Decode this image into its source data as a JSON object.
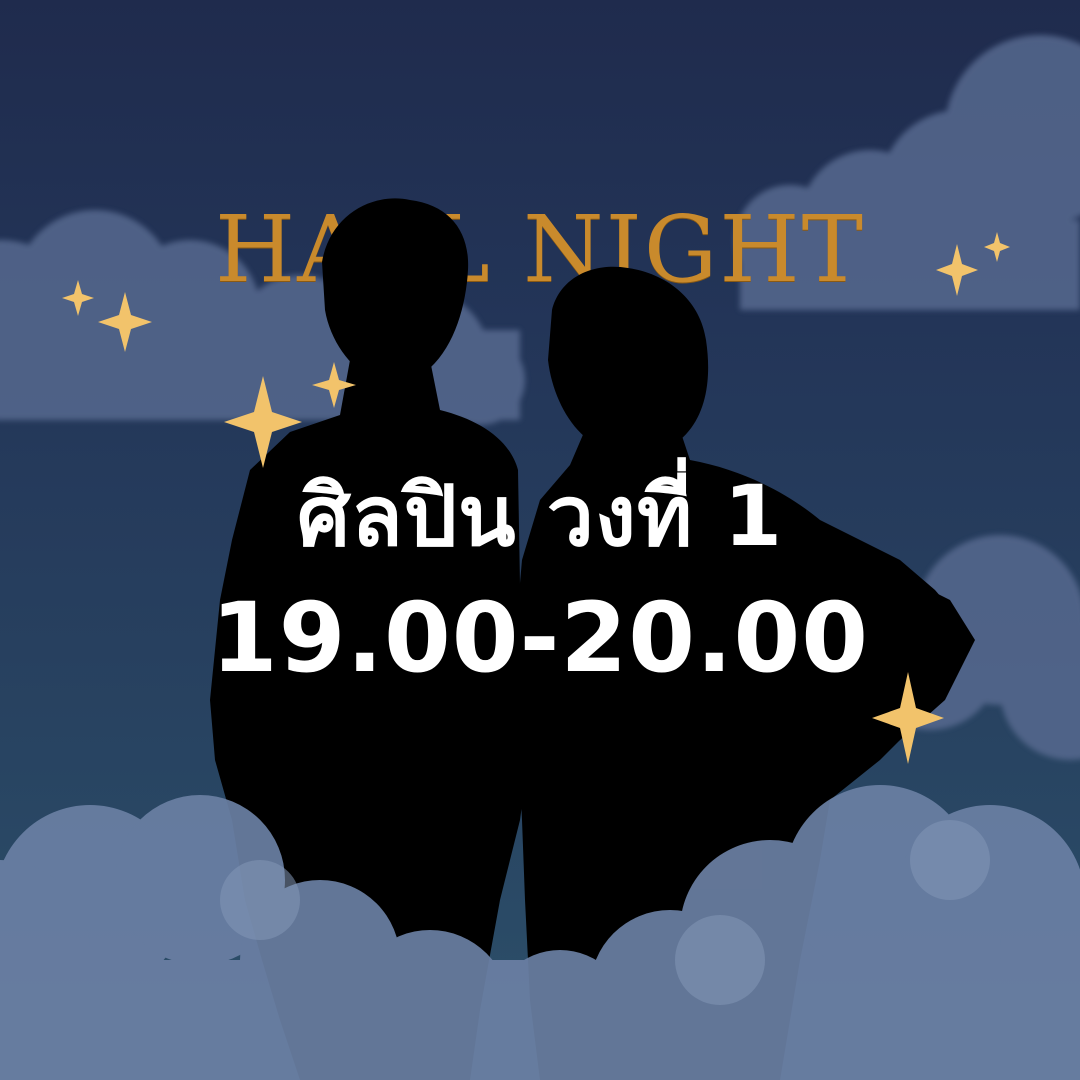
{
  "poster": {
    "title": "HALL NIGHT",
    "artist_label": "ศิลปิน วงที่ 1",
    "time_range": "19.00-20.00"
  },
  "colors": {
    "sky_top": "#1f2b4d",
    "sky_bottom": "#2e5069",
    "cloud": "#5f7599",
    "cloud_light": "#7b90b0",
    "gold": "#c98a2c",
    "star": "#f2c36b",
    "silhouette": "#000000",
    "text": "#ffffff"
  },
  "icons": {
    "sparkle": "four-point-star-icon",
    "silhouette": "two-person-silhouette"
  }
}
